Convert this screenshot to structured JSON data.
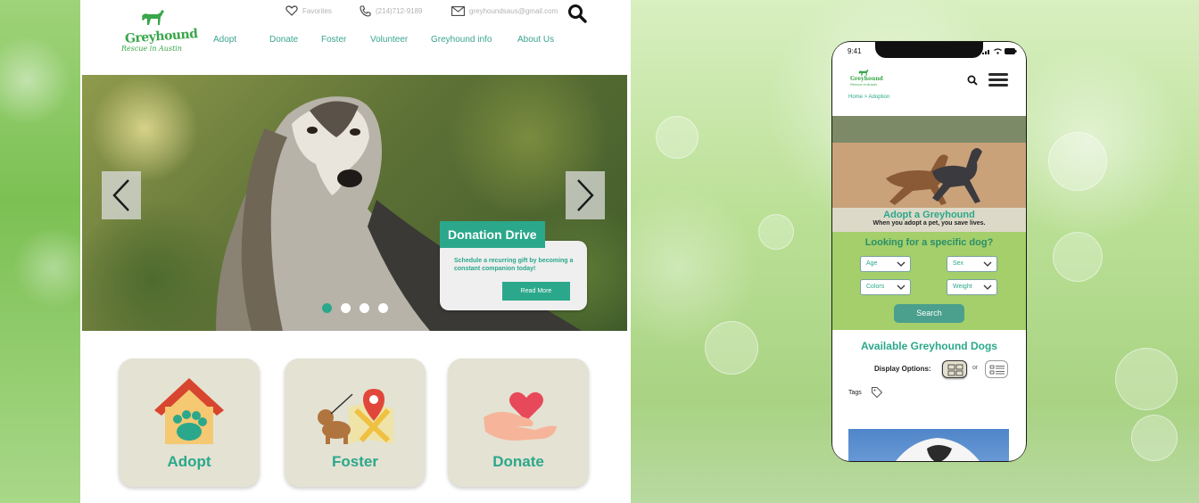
{
  "desktop": {
    "logo": {
      "title": "Greyhound",
      "subtitle": "Rescue in Austin"
    },
    "nav": [
      "Adopt",
      "Donate",
      "Foster",
      "Volunteer",
      "Greyhound info",
      "About Us"
    ],
    "contact": {
      "favorites": "Favorites",
      "phone": "(214)712-9189",
      "email": "greyhoundsaus@gmail.com"
    },
    "hero": {
      "card_title": "Donation Drive",
      "card_text": "Schedule a recurring gift by becoming a constant companion today!",
      "card_button": "Read More",
      "slides": 4,
      "active_slide": 1
    },
    "tiles": [
      {
        "label": "Adopt",
        "icon": "house-paw-icon"
      },
      {
        "label": "Foster",
        "icon": "dog-map-icon"
      },
      {
        "label": "Donate",
        "icon": "heart-hand-icon"
      }
    ]
  },
  "mobile": {
    "status_time": "9:41",
    "logo": {
      "title": "Greyhound",
      "subtitle": "Rescue in Austin"
    },
    "breadcrumb": "Home > Adoption",
    "hero_title": "Adopt a Greyhound",
    "hero_subtitle": "When you adopt a pet, you save lives.",
    "filter_title": "Looking for a specific dog?",
    "filters": {
      "age": "Age",
      "sex": "Sex",
      "colors": "Colors",
      "weight": "Weight"
    },
    "search_button": "Search",
    "available_title": "Available Greyhound Dogs",
    "display_options": "Display Options:",
    "or": "or",
    "tags": "Tags"
  },
  "colors": {
    "accent": "#2ba88b",
    "brand_green": "#39a64a",
    "filter_bg": "#a4cf6b",
    "tile_bg": "#e4e2d3"
  }
}
